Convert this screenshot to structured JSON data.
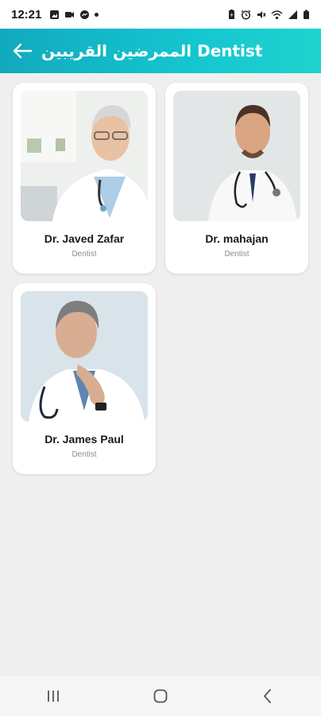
{
  "status_bar": {
    "time": "12:21",
    "left_icons": [
      "gallery-icon",
      "video-icon",
      "messenger-icon",
      "dot-icon"
    ],
    "right_icons": [
      "battery-saver-icon",
      "alarm-icon",
      "mute-icon",
      "wifi-icon",
      "signal-icon",
      "battery-icon"
    ]
  },
  "header": {
    "title": "الممرضين القريبين Dentist",
    "back_icon": "arrow-left-icon",
    "colors": {
      "gradient_start": "#12a9be",
      "gradient_end": "#1fd3cf"
    }
  },
  "doctors": [
    {
      "name": "Dr. Javed Zafar",
      "specialty": "Dentist",
      "photo": "doctor-photo"
    },
    {
      "name": "Dr. mahajan",
      "specialty": "Dentist",
      "photo": "doctor-photo"
    },
    {
      "name": "Dr. James Paul",
      "specialty": "Dentist",
      "photo": "doctor-photo"
    }
  ],
  "nav_bar": {
    "buttons": [
      "recent-apps-icon",
      "home-icon",
      "back-icon"
    ]
  }
}
